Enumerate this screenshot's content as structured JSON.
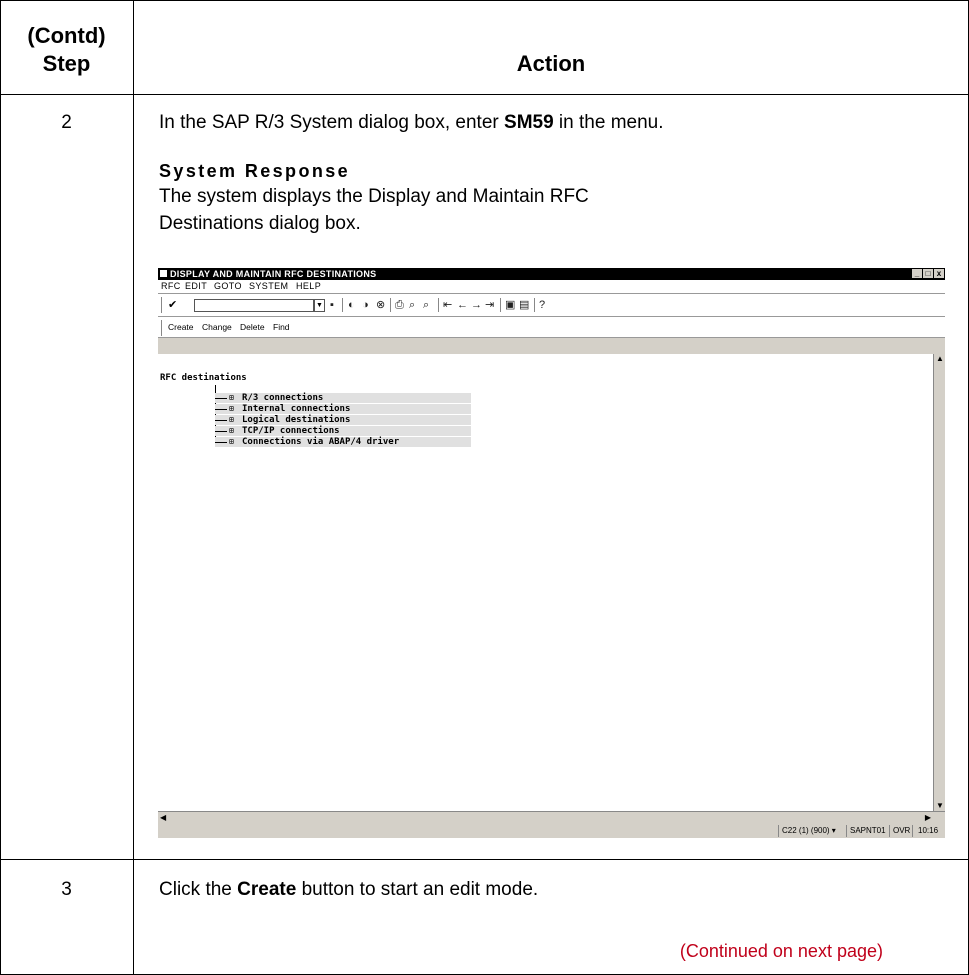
{
  "header": {
    "step_line1": "(Contd)",
    "step_line2": "Step",
    "action": "Action"
  },
  "rows": [
    {
      "step": "2",
      "text_prefix": "In the SAP R/3 System dialog box, enter ",
      "text_bold": "SM59",
      "text_suffix": " in the menu.",
      "system_response_heading": "System Response",
      "system_response_line1": "The system displays the Display and Maintain RFC",
      "system_response_line2": "Destinations dialog box."
    },
    {
      "step": "3",
      "text_prefix": "Click the ",
      "text_bold": "Create",
      "text_suffix": " button to start an edit mode."
    }
  ],
  "continued": "(Continued on next page)",
  "sap_window": {
    "title": "DISPLAY AND MAINTAIN RFC DESTINATIONS",
    "window_controls": [
      "_",
      "□",
      "x"
    ],
    "menu": [
      "RFC",
      "EDIT",
      "GOTO",
      "SYSTEM",
      "HELP"
    ],
    "toolbar_icons": [
      "enter-icon",
      "save-icon",
      "back-icon",
      "exit-icon",
      "cancel-icon",
      "print-icon",
      "find-icon",
      "find-next-icon",
      "first-page-icon",
      "previous-page-icon",
      "next-page-icon",
      "last-page-icon",
      "create-session-icon",
      "shortcut-icon",
      "help-icon"
    ],
    "app_buttons": [
      "Create",
      "Change",
      "Delete",
      "Find"
    ],
    "tree_root": "RFC destinations",
    "tree_nodes": [
      "R/3 connections",
      "Internal connections",
      "Logical destinations",
      "TCP/IP connections",
      "Connections via ABAP/4 driver"
    ],
    "status": {
      "system": "C22 (1) (900) ▾",
      "server": "SAPNT01",
      "mode": "OVR",
      "time": "10:16"
    }
  }
}
